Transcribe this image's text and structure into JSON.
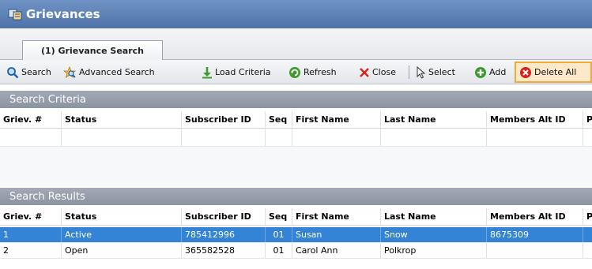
{
  "window": {
    "title": "Grievances",
    "icon": "grievances-app-icon"
  },
  "tabs": [
    {
      "label": "(1) Grievance Search",
      "active": true
    }
  ],
  "toolbar": {
    "search": "Search",
    "advanced_search": "Advanced Search",
    "load_criteria": "Load Criteria",
    "refresh": "Refresh",
    "close": "Close",
    "select": "Select",
    "add": "Add",
    "delete_all": "Delete All"
  },
  "search_criteria": {
    "header": "Search Criteria",
    "columns": [
      "Griev. #",
      "Status",
      "Subscriber ID",
      "Seq",
      "First Name",
      "Last Name",
      "Members Alt ID",
      "P"
    ],
    "rows": [
      [
        "",
        "",
        "",
        "",
        "",
        "",
        "",
        ""
      ]
    ]
  },
  "search_results": {
    "header": "Search Results",
    "columns": [
      "Griev. #",
      "Status",
      "Subscriber ID",
      "Seq",
      "First Name",
      "Last Name",
      "Members Alt ID",
      "P"
    ],
    "rows": [
      {
        "griev": "1",
        "status": "Active",
        "subscriber_id": "785412996",
        "seq": "01",
        "first_name": "Susan",
        "last_name": "Snow",
        "alt_id": "8675309",
        "p": "",
        "selected": true
      },
      {
        "griev": "2",
        "status": "Open",
        "subscriber_id": "365582528",
        "seq": "01",
        "first_name": "Carol Ann",
        "last_name": "Polkrop",
        "alt_id": "",
        "p": "",
        "selected": false
      }
    ]
  },
  "colors": {
    "titlebar": "#5a7eb4",
    "section_header": "#959eab",
    "selected_row": "#3384d6",
    "highlight_border": "#f0a93a"
  }
}
